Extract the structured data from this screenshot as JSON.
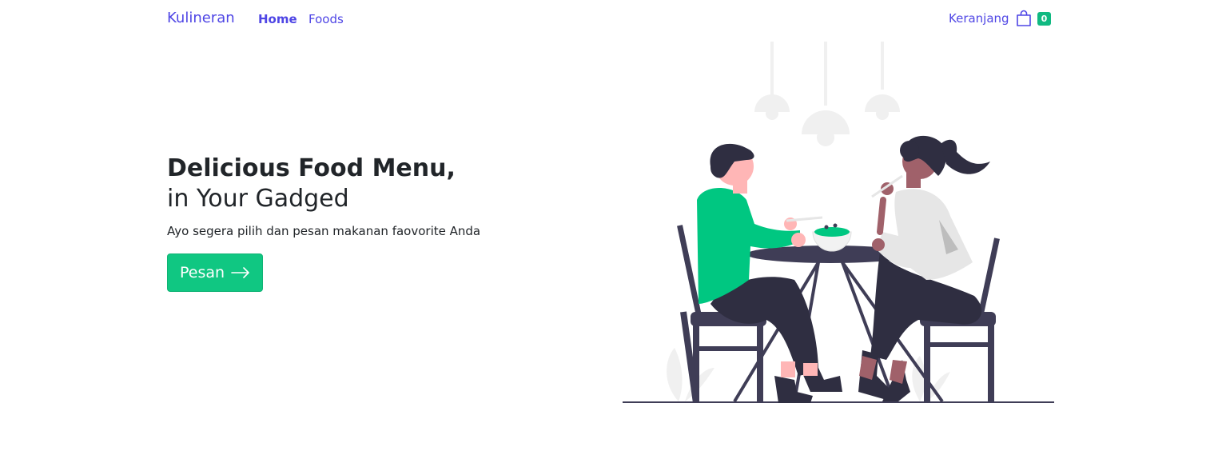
{
  "navbar": {
    "brand": "Kulineran",
    "links": [
      {
        "label": "Home",
        "active": true
      },
      {
        "label": "Foods",
        "active": false
      }
    ],
    "cart": {
      "label": "Keranjang",
      "count": "0",
      "icon": "shopping-bag-icon"
    }
  },
  "hero": {
    "title": "Delicious Food Menu,",
    "subtitle": "in Your Gadged",
    "description": "Ayo segera pilih dan pesan makanan faovorite Anda",
    "button": {
      "label": "Pesan",
      "icon": "arrow-right-icon"
    }
  },
  "colors": {
    "primary": "#4f46e5",
    "accent": "#10c782",
    "badge": "#10b981",
    "illustration_dark": "#3f3d56",
    "illustration_green": "#00c781"
  }
}
